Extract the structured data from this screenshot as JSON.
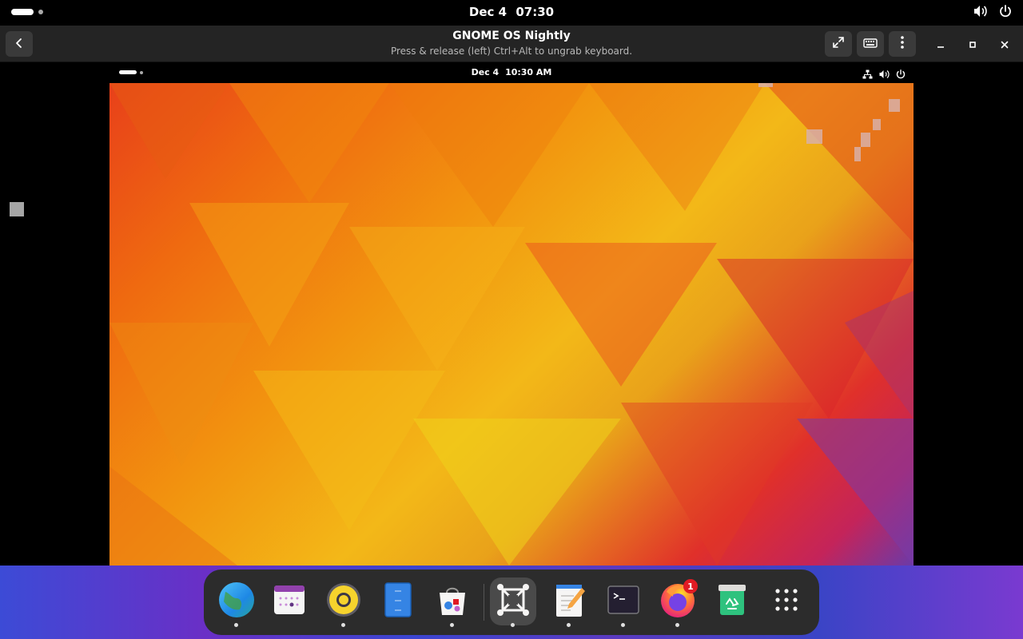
{
  "host_topbar": {
    "date": "Dec 4",
    "time": "07:30",
    "icons": [
      "volume-icon",
      "power-icon"
    ]
  },
  "header": {
    "title": "GNOME OS Nightly",
    "subtitle": "Press & release (left) Ctrl+Alt to ungrab keyboard.",
    "buttons": [
      "back-icon",
      "fullscreen-icon",
      "keyboard-icon",
      "menu-icon",
      "minimize-icon",
      "maximize-icon",
      "close-icon"
    ]
  },
  "vm_topbar": {
    "date": "Dec 4",
    "time": "10:30 AM",
    "icons": [
      "network-icon",
      "volume-icon",
      "power-icon"
    ]
  },
  "dock": {
    "items": [
      {
        "name": "web-browser",
        "running": true
      },
      {
        "name": "calendar",
        "running": false
      },
      {
        "name": "rhythmbox",
        "running": true
      },
      {
        "name": "files",
        "running": false
      },
      {
        "name": "software",
        "running": true
      },
      {
        "name": "boxes",
        "running": true,
        "active": true
      },
      {
        "name": "text-editor",
        "running": true
      },
      {
        "name": "terminal",
        "running": true
      },
      {
        "name": "firefox",
        "running": true,
        "badge": "1"
      },
      {
        "name": "trash",
        "running": false
      },
      {
        "name": "show-apps",
        "running": false
      }
    ]
  }
}
